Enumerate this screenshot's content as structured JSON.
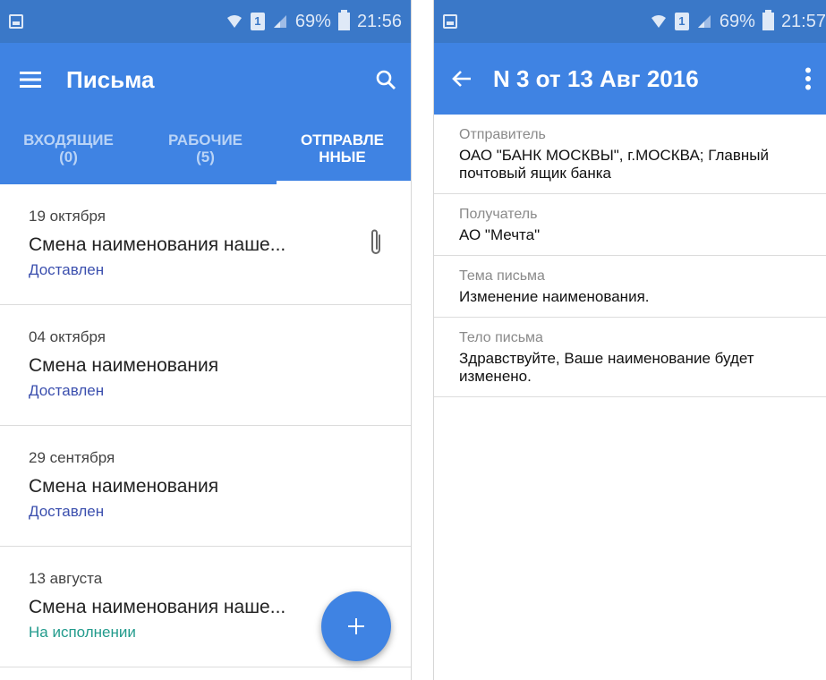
{
  "left": {
    "status": {
      "battery": "69%",
      "time": "21:56"
    },
    "appbar": {
      "title": "Письма"
    },
    "tabs": [
      {
        "label": "ВХОДЯЩИЕ",
        "count": "(0)"
      },
      {
        "label": "РАБОЧИЕ",
        "count": "(5)"
      },
      {
        "label": "ОТПРАВЛЕ",
        "count": "ННЫЕ"
      }
    ],
    "messages": [
      {
        "date": "19 октября",
        "subject": "Смена наименования наше...",
        "status": "Доставлен"
      },
      {
        "date": "04 октября",
        "subject": "Смена наименования",
        "status": "Доставлен"
      },
      {
        "date": "29 сентября",
        "subject": "Смена наименования",
        "status": "Доставлен"
      },
      {
        "date": "13 августа",
        "subject": "Смена наименования наше...",
        "status": "На исполнении"
      }
    ]
  },
  "right": {
    "status": {
      "battery": "69%",
      "time": "21:57"
    },
    "appbar": {
      "title": "N 3 от 13 Авг 2016"
    },
    "fields": [
      {
        "label": "Отправитель",
        "value": "ОАО \"БАНК МОСКВЫ\", г.МОСКВА; Главный почтовый ящик банка"
      },
      {
        "label": "Получатель",
        "value": "АО \"Мечта\""
      },
      {
        "label": "Тема письма",
        "value": "Изменение наименования."
      },
      {
        "label": "Тело письма",
        "value": "Здравствуйте, Ваше наименование будет изменено."
      }
    ]
  },
  "colors": {
    "primary": "#3f83e3",
    "statusbar": "#3a78c8",
    "delivered": "#3b4fae",
    "in_progress": "#229b8c"
  },
  "icons": [
    "menu-icon",
    "search-icon",
    "attachment-icon",
    "add-icon",
    "back-arrow-icon",
    "more-vert-icon",
    "wifi-icon",
    "signal-icon",
    "sim-icon",
    "battery-icon",
    "screenshot-icon"
  ]
}
